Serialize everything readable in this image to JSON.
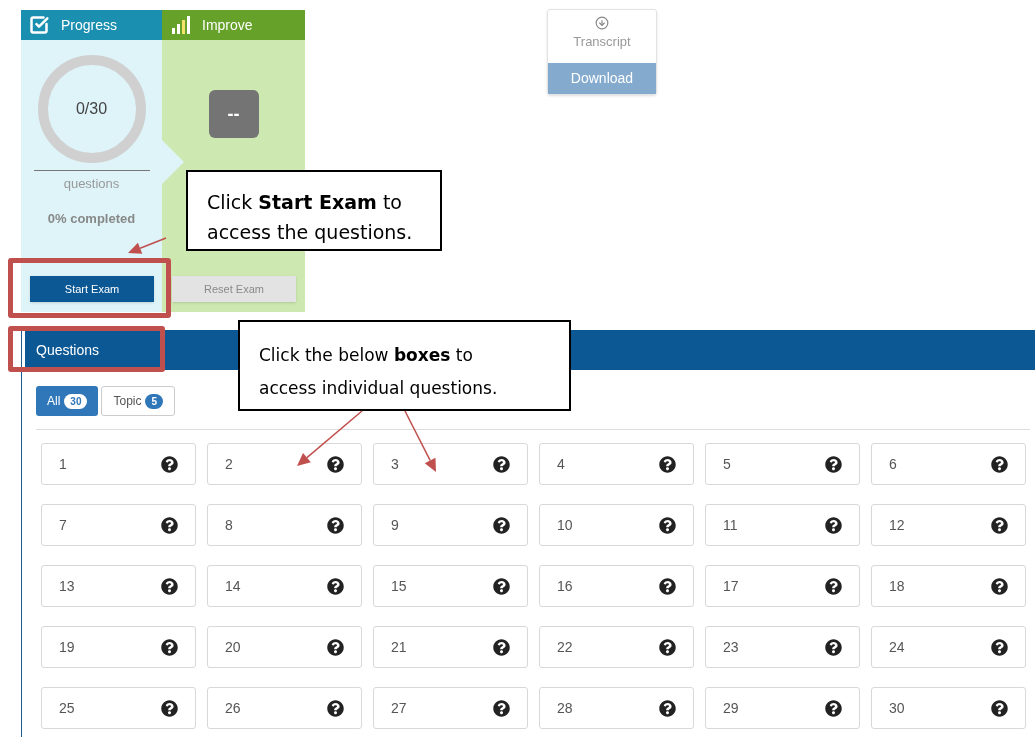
{
  "progress_panel": {
    "title": "Progress",
    "count": "0/30",
    "count_label": "questions",
    "completion": "0% completed",
    "level": 0
  },
  "improve_panel": {
    "title": "Improve",
    "score": "--"
  },
  "buttons": [
    {
      "label": "Start Exam",
      "disabled": false
    },
    {
      "label": "Reset Exam",
      "disabled": true
    }
  ],
  "transcript": {
    "label": "Transcript",
    "button": "Download"
  },
  "questions_section": {
    "title": "Questions",
    "tabs": [
      {
        "label": "All",
        "count": "30",
        "selected": true
      },
      {
        "label": "Topic",
        "count": "5",
        "selected": false
      }
    ],
    "questions": [
      "1",
      "2",
      "3",
      "4",
      "5",
      "6",
      "7",
      "8",
      "9",
      "10",
      "11",
      "12",
      "13",
      "14",
      "15",
      "16",
      "17",
      "18",
      "19",
      "20",
      "21",
      "22",
      "23",
      "24",
      "25",
      "26",
      "27",
      "28",
      "29",
      "30"
    ]
  },
  "callouts": [
    {
      "text": "Click **Start Exam** to access the questions."
    },
    {
      "text": "Click the below **boxes** to access individual questions."
    }
  ]
}
